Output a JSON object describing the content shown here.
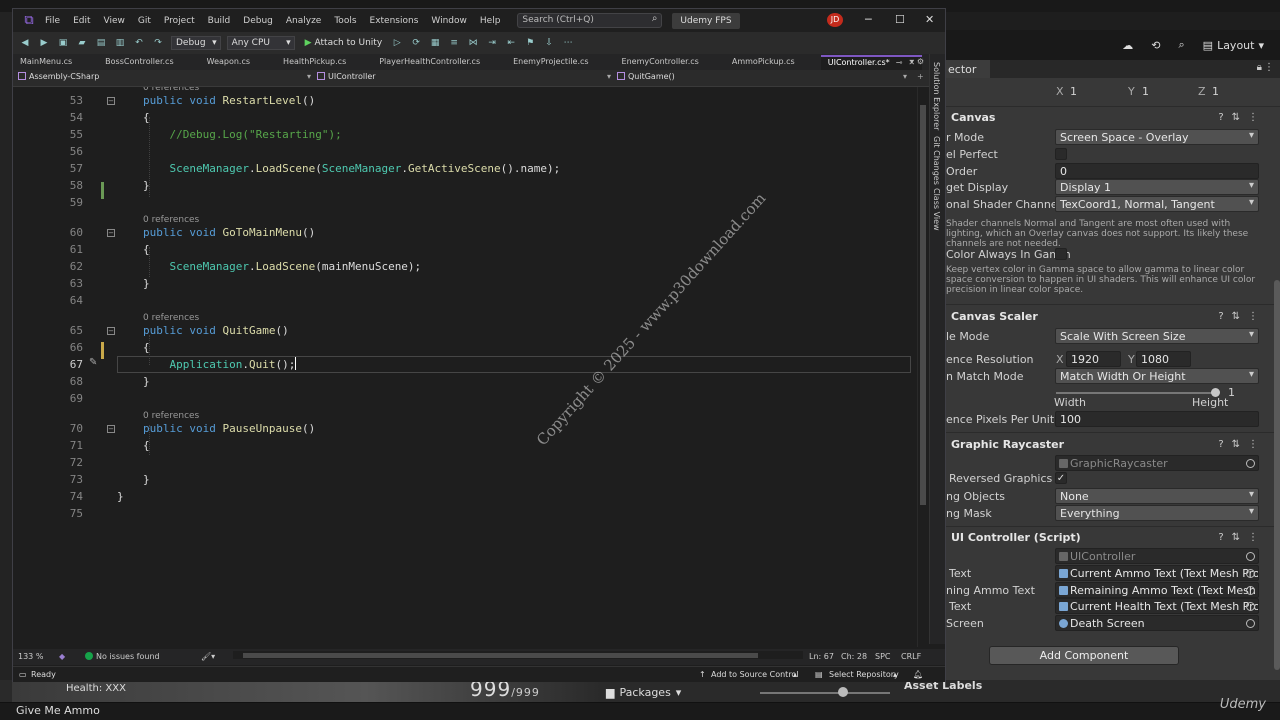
{
  "unity": {
    "toolbar": {
      "layout_label": "Layout"
    },
    "game_view": {
      "health_text": "Health: XXX",
      "score": "999",
      "score_max": "/999"
    },
    "packages_tab": "Packages",
    "asset_labels": "Asset Labels",
    "status_text": "Give Me Ammo",
    "watermark_brand": "Udemy"
  },
  "inspector": {
    "tab_label": "ector",
    "transform_scale": {
      "x_label": "X",
      "x": "1",
      "y_label": "Y",
      "y": "1",
      "z_label": "Z",
      "z": "1"
    },
    "canvas": {
      "header": "Canvas",
      "render_mode_label": "r Mode",
      "render_mode_value": "Screen Space - Overlay",
      "pixel_perfect_label": "el Perfect",
      "sort_order_label": "Order",
      "sort_order_value": "0",
      "target_display_label": "get Display",
      "target_display_value": "Display 1",
      "shader_channels_label": "onal Shader Channels",
      "shader_channels_value": "TexCoord1, Normal, Tangent",
      "shader_help": "Shader channels Normal and Tangent are most often used with lighting, which an Overlay canvas does not support. Its likely these channels are not needed.",
      "gamma_label": "Color Always In Gamm",
      "gamma_help": "Keep vertex color in Gamma space to allow gamma to linear color space conversion to happen in UI shaders. This will enhance UI color precision in linear color space."
    },
    "canvas_scaler": {
      "header": "Canvas Scaler",
      "scale_mode_label": "le Mode",
      "scale_mode_value": "Scale With Screen Size",
      "ref_resolution_label": "ence Resolution",
      "ref_x_label": "X",
      "ref_x": "1920",
      "ref_y_label": "Y",
      "ref_y": "1080",
      "match_mode_label": "n Match Mode",
      "match_mode_value": "Match Width Or Height",
      "match_value": "1",
      "match_fraction": 1,
      "width_label": "Width",
      "height_label": "Height",
      "ref_ppu_label": "ence Pixels Per Unit",
      "ref_ppu": "100"
    },
    "graphic_raycaster": {
      "header": "Graphic Raycaster",
      "script_value": "GraphicRaycaster",
      "ignore_reversed_label": "Reversed Graphics",
      "blocking_objects_label": "ng Objects",
      "blocking_objects_value": "None",
      "blocking_mask_label": "ng Mask",
      "blocking_mask_value": "Everything"
    },
    "ui_controller": {
      "header": "UI Controller (Script)",
      "script_value": "UIController",
      "fields": [
        {
          "label": "Text",
          "value": "Current Ammo Text (Text Mesh Pro UG"
        },
        {
          "label": "ning Ammo Text",
          "value": "Remaining Ammo Text (Text Mesh Pro"
        },
        {
          "label": "Text",
          "value": "Current Health Text (Text Mesh Pro UG"
        },
        {
          "label": "Screen",
          "value": "Death Screen"
        }
      ]
    },
    "add_component": "Add Component"
  },
  "vs": {
    "menu": [
      "File",
      "Edit",
      "View",
      "Git",
      "Project",
      "Build",
      "Debug",
      "Analyze",
      "Tools",
      "Extensions",
      "Window",
      "Help"
    ],
    "search_placeholder": "Search (Ctrl+Q)",
    "project_name": "Udemy FPS",
    "avatar_initials": "JD",
    "toolbar": {
      "configuration": "Debug",
      "platform": "Any CPU",
      "attach_label": "Attach to Unity"
    },
    "tabs": [
      {
        "label": "MainMenu.cs",
        "active": false
      },
      {
        "label": "BossController.cs",
        "active": false
      },
      {
        "label": "Weapon.cs",
        "active": false
      },
      {
        "label": "HealthPickup.cs",
        "active": false
      },
      {
        "label": "PlayerHealthController.cs",
        "active": false
      },
      {
        "label": "EnemyProjectile.cs",
        "active": false
      },
      {
        "label": "EnemyController.cs",
        "active": false
      },
      {
        "label": "AmmoPickup.cs",
        "active": false
      },
      {
        "label": "UIController.cs*",
        "active": true
      }
    ],
    "nav": {
      "project": "Assembly-CSharp",
      "class": "UIController",
      "member": "QuitGame()"
    },
    "side_labels": [
      "Solution Explorer",
      "Git Changes",
      "Class View"
    ],
    "code_lines": [
      {
        "n": "53",
        "t": [
          [
            "kw",
            "public void "
          ],
          [
            "fn",
            "RestartLevel"
          ],
          [
            "pl",
            "()"
          ]
        ],
        "lens": "0 references",
        "fold": true
      },
      {
        "n": "54",
        "t": [
          [
            "pl",
            "{"
          ]
        ]
      },
      {
        "n": "55",
        "t": [
          [
            "pl",
            "    "
          ],
          [
            "cm",
            "//Debug.Log(\"Restarting\");"
          ]
        ]
      },
      {
        "n": "56",
        "t": []
      },
      {
        "n": "57",
        "t": [
          [
            "pl",
            "    "
          ],
          [
            "ty",
            "SceneManager"
          ],
          [
            "pl",
            "."
          ],
          [
            "fn",
            "LoadScene"
          ],
          [
            "pl",
            "("
          ],
          [
            "ty",
            "SceneManager"
          ],
          [
            "pl",
            "."
          ],
          [
            "fn",
            "GetActiveScene"
          ],
          [
            "pl",
            "().name);"
          ]
        ]
      },
      {
        "n": "58",
        "t": [
          [
            "pl",
            "}"
          ]
        ]
      },
      {
        "n": "59",
        "t": []
      },
      {
        "n": "60",
        "t": [
          [
            "kw",
            "public void "
          ],
          [
            "fn",
            "GoToMainMenu"
          ],
          [
            "pl",
            "()"
          ]
        ],
        "lens": "0 references",
        "fold": true
      },
      {
        "n": "61",
        "t": [
          [
            "pl",
            "{"
          ]
        ]
      },
      {
        "n": "62",
        "t": [
          [
            "pl",
            "    "
          ],
          [
            "ty",
            "SceneManager"
          ],
          [
            "pl",
            "."
          ],
          [
            "fn",
            "LoadScene"
          ],
          [
            "pl",
            "(mainMenuScene);"
          ]
        ]
      },
      {
        "n": "63",
        "t": [
          [
            "pl",
            "}"
          ]
        ]
      },
      {
        "n": "64",
        "t": []
      },
      {
        "n": "65",
        "t": [
          [
            "kw",
            "public void "
          ],
          [
            "fn",
            "QuitGame"
          ],
          [
            "pl",
            "()"
          ]
        ],
        "lens": "0 references",
        "fold": true
      },
      {
        "n": "66",
        "t": [
          [
            "pl",
            "{"
          ]
        ]
      },
      {
        "n": "67",
        "t": [
          [
            "pl",
            "    "
          ],
          [
            "ty",
            "Application"
          ],
          [
            "pl",
            "."
          ],
          [
            "fn",
            "Quit"
          ],
          [
            "pl",
            "();"
          ]
        ],
        "current": true
      },
      {
        "n": "68",
        "t": [
          [
            "pl",
            "}"
          ]
        ]
      },
      {
        "n": "69",
        "t": []
      },
      {
        "n": "70",
        "t": [
          [
            "kw",
            "public void "
          ],
          [
            "fn",
            "PauseUnpause"
          ],
          [
            "pl",
            "()"
          ]
        ],
        "lens": "0 references",
        "fold": true
      },
      {
        "n": "71",
        "t": [
          [
            "pl",
            "{"
          ]
        ]
      },
      {
        "n": "72",
        "t": []
      },
      {
        "n": "73",
        "t": [
          [
            "pl",
            "}"
          ]
        ]
      },
      {
        "n": "74",
        "t": [
          [
            "pl",
            "}"
          ]
        ],
        "outer": true
      },
      {
        "n": "75",
        "t": []
      }
    ],
    "watermark": "Copyright © 2025 - www.p30download.com",
    "info": {
      "zoom": "133 %",
      "issues": "No issues found",
      "position": "Ln: 67",
      "column": "Ch: 28",
      "spacing": "SPC",
      "line_ending": "CRLF"
    },
    "status": {
      "state": "Ready",
      "source_control": "Add to Source Control",
      "repository": "Select Repository"
    }
  }
}
